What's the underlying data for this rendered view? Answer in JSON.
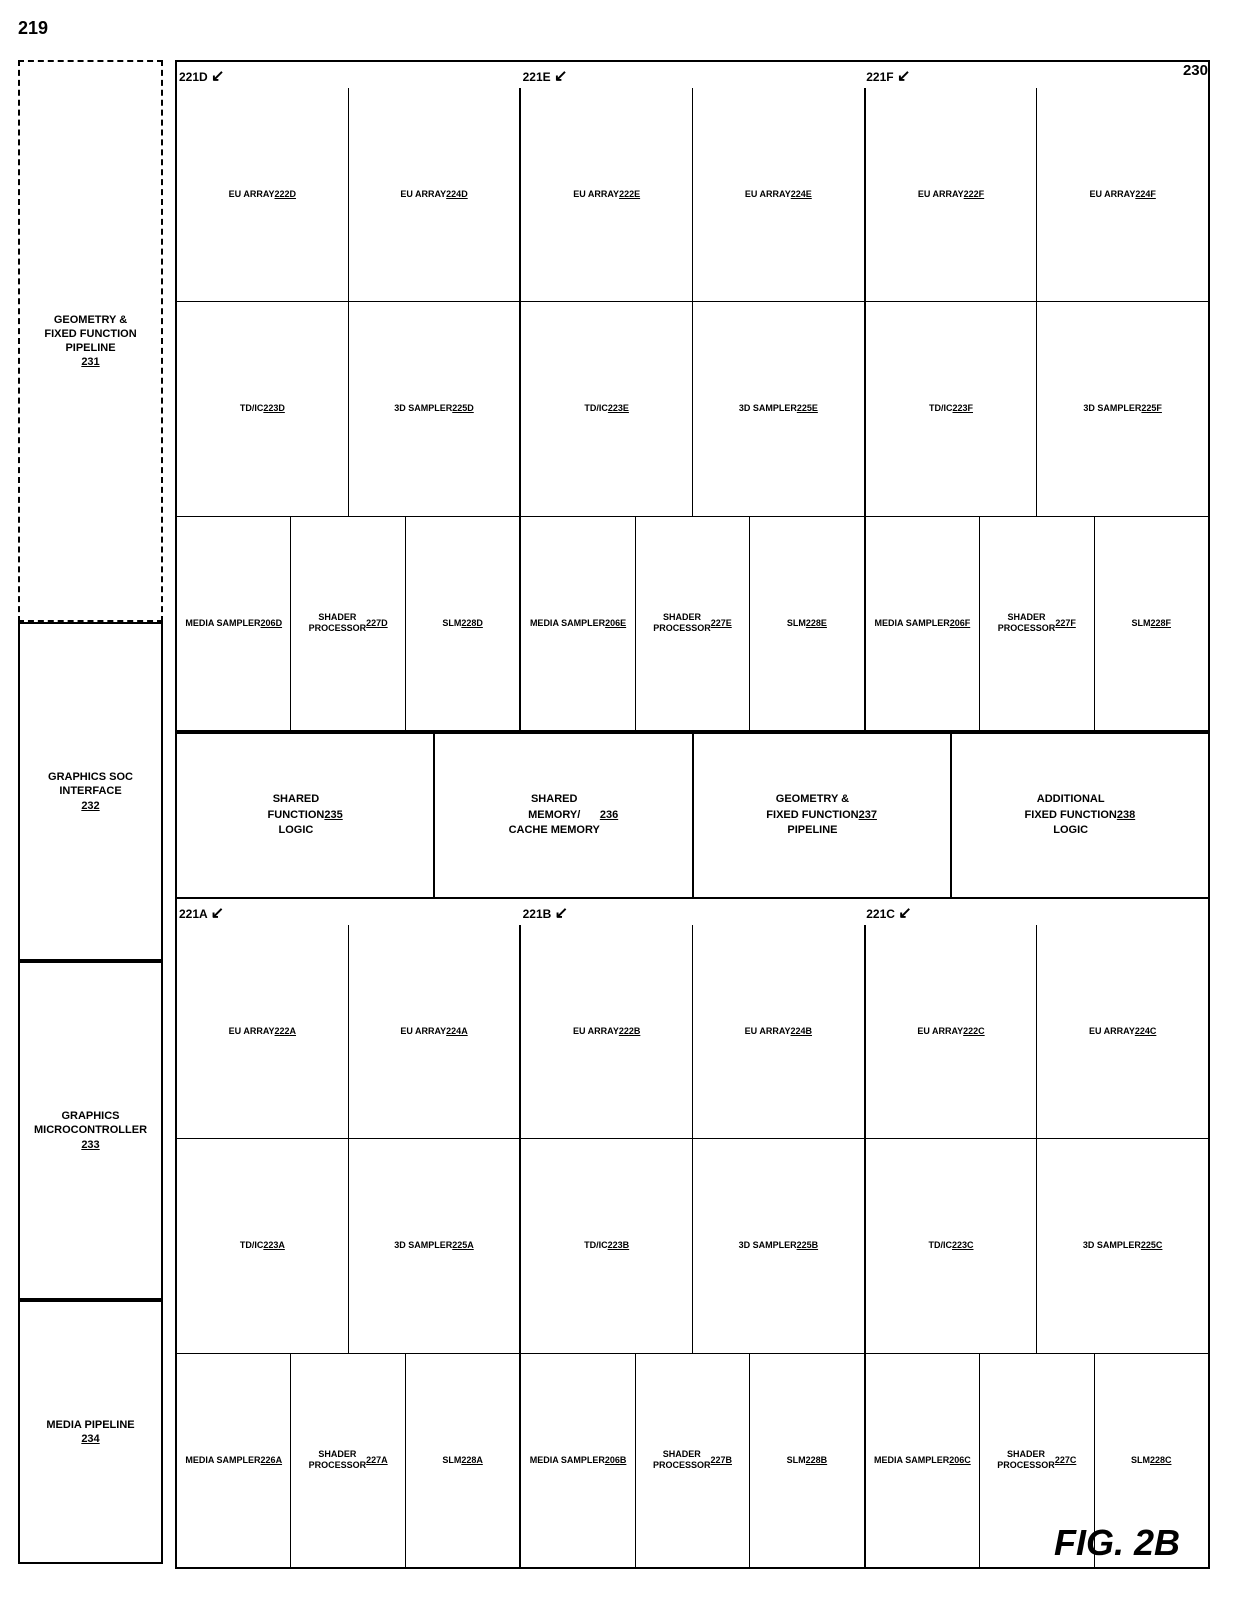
{
  "page": {
    "number": "219",
    "fig_label": "FIG. 2B",
    "outer_label": "230"
  },
  "left_boxes": [
    {
      "id": "231",
      "label": "GEOMETRY &\nFIXED FUNCTION\nPIPELINE",
      "ref": "231",
      "dashed": true
    },
    {
      "id": "232",
      "label": "GRAPHICS SOC\nINTERFACE",
      "ref": "232",
      "dashed": false
    },
    {
      "id": "233",
      "label": "GRAPHICS\nMICROCONTROLLER",
      "ref": "233",
      "dashed": false
    },
    {
      "id": "234",
      "label": "MEDIA PIPELINE",
      "ref": "234",
      "dashed": false
    }
  ],
  "top_slices": [
    {
      "label": "221D",
      "rows": [
        [
          {
            "text": "EU ARRAY\n222D",
            "ref": "222D"
          },
          {
            "text": "EU ARRAY\n224D",
            "ref": "224D"
          }
        ],
        [
          {
            "text": "TD/IC\n223D",
            "ref": "223D"
          },
          {
            "text": "3D SAMPLER\n225D",
            "ref": "225D"
          }
        ],
        [
          {
            "text": "MEDIA SAMPLER\n206D",
            "ref": "206D"
          },
          {
            "text": "SHADER\nPROCESSOR\n227D",
            "ref": "227D"
          },
          {
            "text": "SLM\n228D",
            "ref": "228D"
          }
        ]
      ]
    },
    {
      "label": "221E",
      "rows": [
        [
          {
            "text": "EU ARRAY\n222E",
            "ref": "222E"
          },
          {
            "text": "EU ARRAY\n224E",
            "ref": "224E"
          }
        ],
        [
          {
            "text": "TD/IC\n223E",
            "ref": "223E"
          },
          {
            "text": "3D SAMPLER\n225E",
            "ref": "225E"
          }
        ],
        [
          {
            "text": "MEDIA SAMPLER\n206E",
            "ref": "206E"
          },
          {
            "text": "SHADER\nPROCESSOR\n227E",
            "ref": "227E"
          },
          {
            "text": "SLM\n228E",
            "ref": "228E"
          }
        ]
      ]
    },
    {
      "label": "221F",
      "rows": [
        [
          {
            "text": "EU ARRAY\n222F",
            "ref": "222F"
          },
          {
            "text": "EU ARRAY\n224F",
            "ref": "224F"
          }
        ],
        [
          {
            "text": "TD/IC\n223F",
            "ref": "223F"
          },
          {
            "text": "3D SAMPLER\n225F",
            "ref": "225F"
          }
        ],
        [
          {
            "text": "MEDIA SAMPLER\n206F",
            "ref": "206F"
          },
          {
            "text": "SHADER\nPROCESSOR\n227F",
            "ref": "227F"
          },
          {
            "text": "SLM\n228F",
            "ref": "228F"
          }
        ]
      ]
    }
  ],
  "bottom_slices": [
    {
      "label": "221A",
      "rows": [
        [
          {
            "text": "EU ARRAY\n222A",
            "ref": "222A"
          },
          {
            "text": "EU ARRAY\n224A",
            "ref": "224A"
          }
        ],
        [
          {
            "text": "TD/IC\n223A",
            "ref": "223A"
          },
          {
            "text": "3D SAMPLER\n225A",
            "ref": "225A"
          }
        ],
        [
          {
            "text": "MEDIA SAMPLER\n226A",
            "ref": "226A"
          },
          {
            "text": "SHADER\nPROCESSOR\n227A",
            "ref": "227A"
          },
          {
            "text": "SLM\n228A",
            "ref": "228A"
          }
        ]
      ]
    },
    {
      "label": "221B",
      "rows": [
        [
          {
            "text": "EU ARRAY\n222B",
            "ref": "222B"
          },
          {
            "text": "EU ARRAY\n224B",
            "ref": "224B"
          }
        ],
        [
          {
            "text": "TD/IC\n223B",
            "ref": "223B"
          },
          {
            "text": "3D SAMPLER\n225B",
            "ref": "225B"
          }
        ],
        [
          {
            "text": "MEDIA SAMPLER\n206B",
            "ref": "206B"
          },
          {
            "text": "SHADER\nPROCESSOR\n227B",
            "ref": "227B"
          },
          {
            "text": "SLM\n228B",
            "ref": "228B"
          }
        ]
      ]
    },
    {
      "label": "221C",
      "rows": [
        [
          {
            "text": "EU ARRAY\n222C",
            "ref": "222C"
          },
          {
            "text": "EU ARRAY\n224C",
            "ref": "224C"
          }
        ],
        [
          {
            "text": "TD/IC\n223C",
            "ref": "223C"
          },
          {
            "text": "3D SAMPLER\n225C",
            "ref": "225C"
          }
        ],
        [
          {
            "text": "MEDIA SAMPLER\n206C",
            "ref": "206C"
          },
          {
            "text": "SHADER\nPROCESSOR\n227C",
            "ref": "227C"
          },
          {
            "text": "SLM\n228C",
            "ref": "228C"
          }
        ]
      ]
    }
  ],
  "bottom_boxes": [
    {
      "text": "SHARED\nFUNCTION\nLOGIC",
      "ref": "235"
    },
    {
      "text": "SHARED\nMEMORY/\nCACHE MEMORY",
      "ref": "236"
    },
    {
      "text": "GEOMETRY &\nFIXED FUNCTION\nPIPELINE",
      "ref": "237"
    },
    {
      "text": "ADDITIONAL\nFIXED FUNCTION\nLOGIC",
      "ref": "238"
    }
  ]
}
